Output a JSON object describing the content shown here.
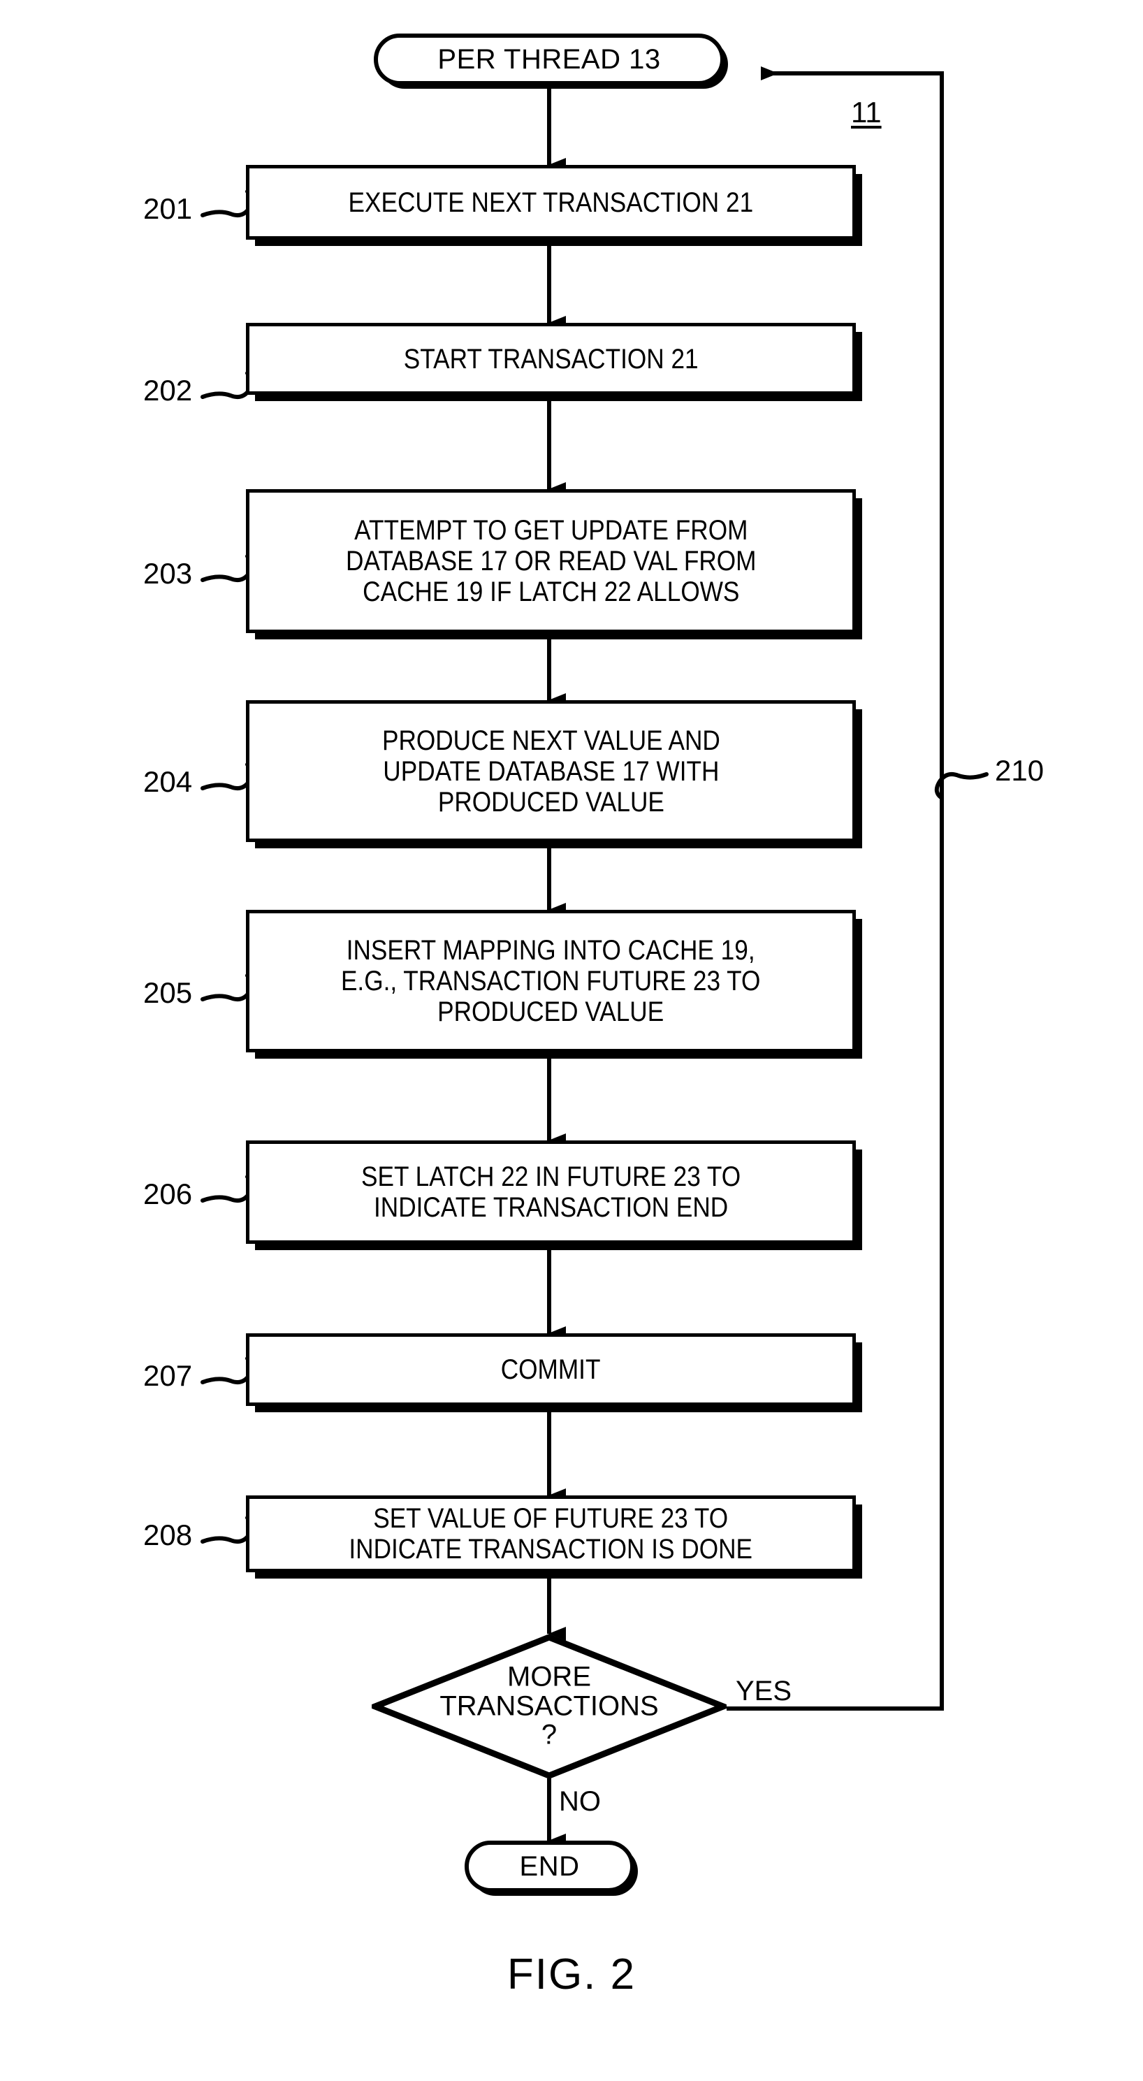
{
  "figure": {
    "caption": "FIG. 2",
    "system_ref": "11",
    "loop_ref": "210"
  },
  "nodes": {
    "start": {
      "type": "terminator",
      "label": "PER THREAD 13"
    },
    "end": {
      "type": "terminator",
      "label": "END"
    },
    "decision": {
      "type": "decision",
      "label": "MORE\nTRANSACTIONS\n?",
      "yes_label": "YES",
      "no_label": "NO"
    }
  },
  "steps": [
    {
      "ref": "201",
      "label": "EXECUTE NEXT TRANSACTION 21"
    },
    {
      "ref": "202",
      "label": "START TRANSACTION 21"
    },
    {
      "ref": "203",
      "label": "ATTEMPT TO GET UPDATE FROM\nDATABASE 17 OR READ VAL FROM\nCACHE 19 IF LATCH 22 ALLOWS"
    },
    {
      "ref": "204",
      "label": "PRODUCE NEXT VALUE AND\nUPDATE DATABASE 17 WITH\nPRODUCED VALUE"
    },
    {
      "ref": "205",
      "label": "INSERT MAPPING INTO CACHE 19,\nE.G., TRANSACTION FUTURE 23 TO\nPRODUCED VALUE"
    },
    {
      "ref": "206",
      "label": "SET LATCH 22 IN FUTURE 23 TO\nINDICATE TRANSACTION END"
    },
    {
      "ref": "207",
      "label": "COMMIT"
    },
    {
      "ref": "208",
      "label": "SET VALUE OF FUTURE 23 TO\nINDICATE TRANSACTION IS DONE"
    }
  ],
  "colors": {
    "ink": "#000000",
    "paper": "#ffffff"
  }
}
